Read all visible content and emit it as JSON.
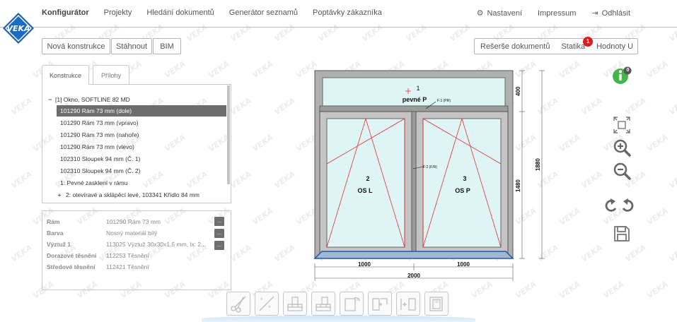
{
  "nav": {
    "brand": "VEKA",
    "items": [
      "Konfigurátor",
      "Projekty",
      "Hledání dokumentů",
      "Generátor seznamů",
      "Poptávky zákazníka"
    ],
    "right_items": [
      {
        "label": "Nastavení",
        "icon": "gear-icon"
      },
      {
        "label": "Impressum",
        "icon": ""
      },
      {
        "label": "Odhlásit",
        "icon": "logout-icon"
      }
    ]
  },
  "toolbar": {
    "new_construction": "Nová konstrukce",
    "download": "Stáhnout",
    "bim": "BIM",
    "doc_search": "Rešerše dokumentů",
    "statics": "Statika",
    "statics_badge": "1",
    "values": "Hodnoty U"
  },
  "tabs": [
    "Konstrukce",
    "Přílohy"
  ],
  "tree": {
    "root": "[1] Okno, SOFTLINE 82 MD",
    "root_toggle": "−",
    "items": [
      "101290 Rám 73 mm (dole)",
      "101290 Rám 73 mm (vpravo)",
      "101290 Rám 73 mm (nahoře)",
      "101290 Rám 73 mm (vlevo)",
      "102310 Sloupek 94 mm (Č. 1)",
      "102310 Sloupek 94 mm (Č. 2)",
      "1: Pevné zasklení v rámu"
    ],
    "collapsed_toggle": "+",
    "collapsed_item": "2: otevíravé a sklápěcí levé, 103341 Křídlo 84 mm"
  },
  "properties": [
    {
      "label": "Rám",
      "value": "101290 Rám 73 mm",
      "has_button": true
    },
    {
      "label": "Barva",
      "value": "Nosný materiál bílý",
      "has_button": true
    },
    {
      "label": "Výztuž 1",
      "value": "113025 Výztuž 30x30x1.5 mm, lx: 2...",
      "has_button": true
    },
    {
      "label": "Dorazové těsnění",
      "value": "112253 Těsnění",
      "has_button": false
    },
    {
      "label": "Středové těsnění",
      "value": "112421 Těsnění",
      "has_button": false
    }
  ],
  "dots_label": "...",
  "drawing": {
    "field1_number": "1",
    "field1_label": "pevné P",
    "field1_note": "F:1 (PR)",
    "field2_number": "2",
    "field2_label": "OS L",
    "field2_note": "F:2 (F/R)",
    "field3_number": "3",
    "field3_label": "OS P",
    "dim_top_height": "400",
    "dim_total_height": "1880",
    "dim_lower_height": "1480",
    "dim_left_width": "1000",
    "dim_right_width": "1000",
    "dim_total_width": "2000"
  },
  "info_badge": "0",
  "colors": {
    "accent_green": "#44b649",
    "badge_red": "#e01b1b",
    "glass": "#dff4f5",
    "frame": "#8a8a8a",
    "selection": "#6d6d6d"
  }
}
